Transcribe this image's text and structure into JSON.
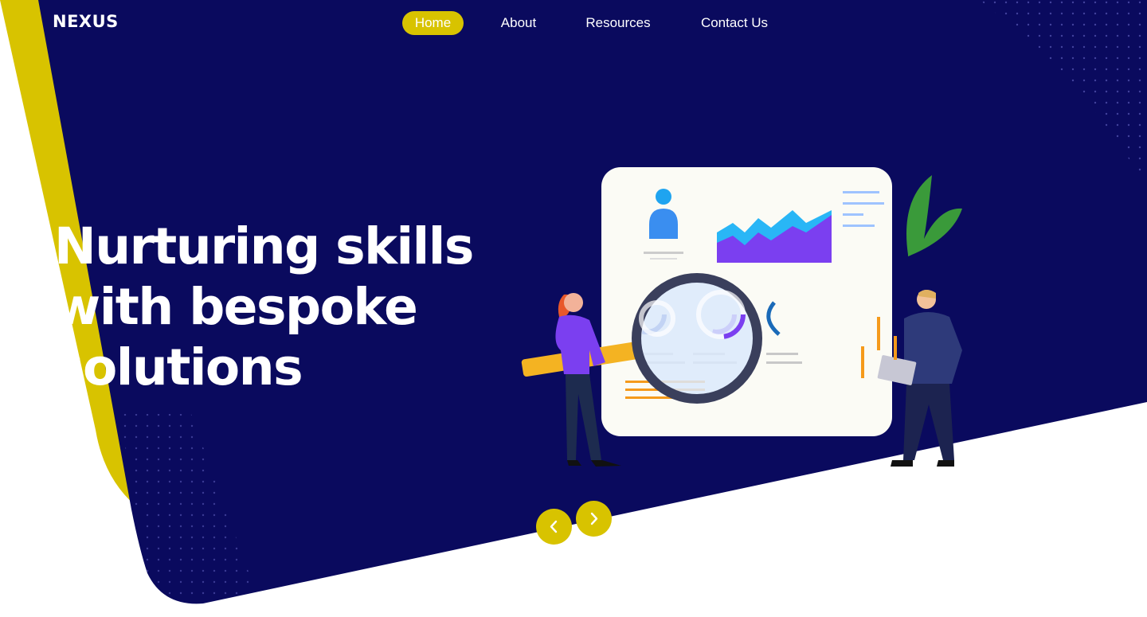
{
  "brand": {
    "logo_text": "NEXUS"
  },
  "nav": {
    "items": [
      {
        "label": "Home",
        "active": true
      },
      {
        "label": "About",
        "active": false
      },
      {
        "label": "Resources",
        "active": false
      },
      {
        "label": "Contact Us",
        "active": false
      }
    ]
  },
  "hero": {
    "title_lines": [
      "Nurturing skills",
      "with bespoke",
      "solutions"
    ],
    "illustration": "analytics-dashboard-magnifier-illustration"
  },
  "carousel": {
    "prev_icon": "chevron-left-icon",
    "next_icon": "chevron-right-icon"
  },
  "colors": {
    "navy": "#0a0a5e",
    "accent_yellow": "#d8c300",
    "white": "#ffffff"
  }
}
